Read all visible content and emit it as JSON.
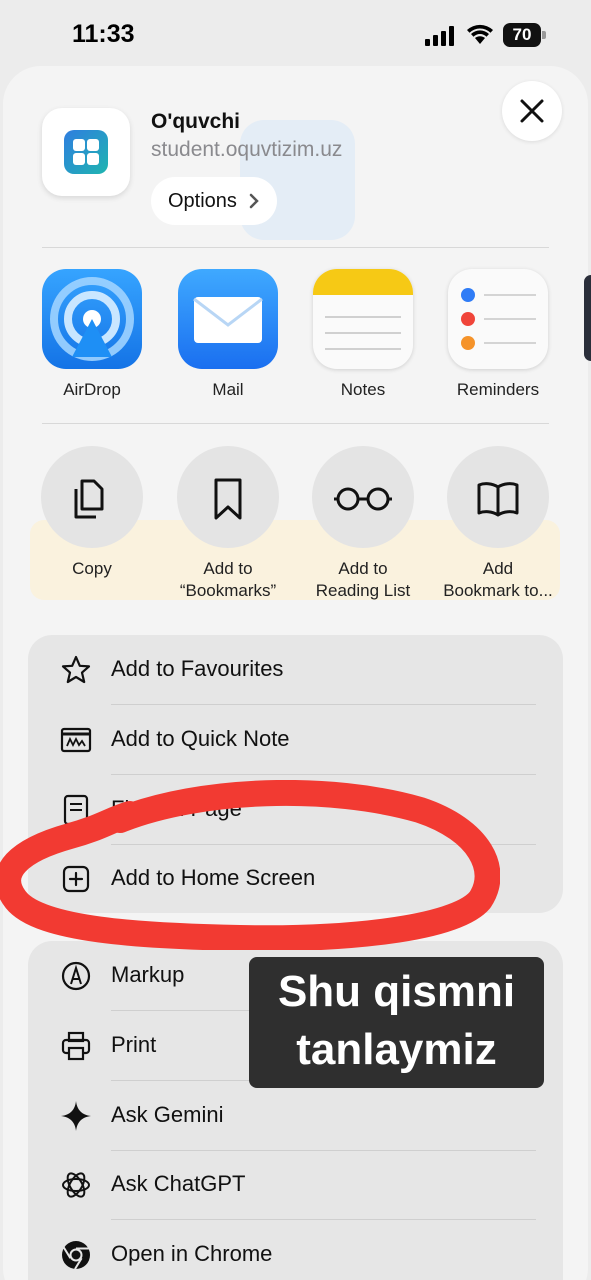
{
  "status_bar": {
    "time": "11:33",
    "battery": "70"
  },
  "site": {
    "title": "O'quvchi",
    "url": "student.oquvtizim.uz",
    "options_label": "Options"
  },
  "apps": [
    {
      "label": "AirDrop",
      "icon": "airdrop-icon"
    },
    {
      "label": "Mail",
      "icon": "mail-icon"
    },
    {
      "label": "Notes",
      "icon": "notes-icon"
    },
    {
      "label": "Reminders",
      "icon": "reminders-icon"
    }
  ],
  "actions": [
    {
      "label": "Copy",
      "icon": "copy-icon"
    },
    {
      "label": "Add to\n“Bookmarks”",
      "icon": "bookmark-icon"
    },
    {
      "label": "Add to\nReading List",
      "icon": "glasses-icon"
    },
    {
      "label": "Add\nBookmark to...",
      "icon": "book-icon"
    }
  ],
  "menu_group_1": [
    {
      "label": "Add to Favourites",
      "icon": "star-icon"
    },
    {
      "label": "Add to Quick Note",
      "icon": "quick-note-icon"
    },
    {
      "label": "Find on Page",
      "icon": "document-icon"
    },
    {
      "label": "Add to Home Screen",
      "icon": "plus-square-icon"
    }
  ],
  "menu_group_2": [
    {
      "label": "Markup",
      "icon": "markup-icon"
    },
    {
      "label": "Print",
      "icon": "printer-icon"
    },
    {
      "label": "Ask Gemini",
      "icon": "gemini-icon"
    },
    {
      "label": "Ask ChatGPT",
      "icon": "chatgpt-icon"
    },
    {
      "label": "Open in Chrome",
      "icon": "chrome-icon"
    }
  ],
  "caption": {
    "line1": "Shu qismni",
    "line2": "tanlaymiz"
  },
  "colors": {
    "annotation_red": "#f23a32",
    "caption_bg": "#2f2f2f",
    "airdrop_blue": "#1e8ff5"
  }
}
